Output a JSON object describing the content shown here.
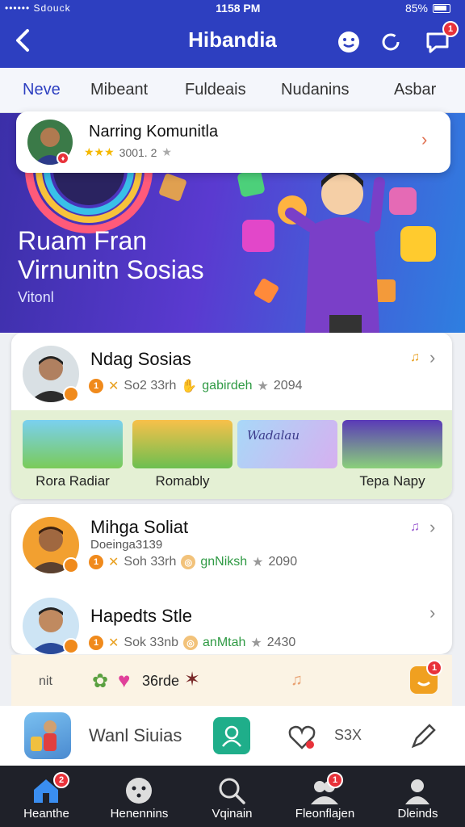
{
  "status": {
    "carrier": "•••••• Sdouck",
    "time": "1158 PM",
    "battery": "85%"
  },
  "appbar": {
    "title": "Hibandia",
    "badge": "1"
  },
  "tabs": [
    "Neve",
    "Mibeant",
    "Fuldeais",
    "Nudanins",
    "Asbar"
  ],
  "popup": {
    "title": "Narring Komunitla",
    "rating": "3001. 2"
  },
  "hero": {
    "line1": "Ruam Fran",
    "line2": "Virnunitn Sosias",
    "sub": "Vitonl"
  },
  "featured": {
    "name": "Ndag Sosias",
    "meta1": "So2 33rh",
    "meta2": "gabirdeh",
    "score": "2094",
    "thumbs": [
      {
        "label": "Rora Radiar",
        "text": ""
      },
      {
        "label": "Romably",
        "text": ""
      },
      {
        "label": "",
        "text": "Wadalau"
      },
      {
        "label": "Tepa Napy",
        "text": ""
      }
    ]
  },
  "list": [
    {
      "name": "Mihga Soliat",
      "sub": "Doeinga3139",
      "meta1": "Soh 33rh",
      "meta2": "gnNiksh",
      "score": "2090"
    },
    {
      "name": "Hapedts Stle",
      "sub": "",
      "meta1": "Sok 33nb",
      "meta2": "anMtah",
      "score": "2430"
    }
  ],
  "actions": {
    "left": "nit",
    "middle": "36rde",
    "badge": "1"
  },
  "bottomrow": {
    "label": "Wanl Siuias",
    "right": "S3X"
  },
  "nav": [
    {
      "label": "Heanthe",
      "badge": "2",
      "active": true
    },
    {
      "label": "Henennins",
      "badge": ""
    },
    {
      "label": "Vqinain",
      "badge": ""
    },
    {
      "label": "Fleonflajen",
      "badge": "1"
    },
    {
      "label": "Dleinds",
      "badge": ""
    }
  ],
  "colors": {
    "primary": "#2d3fc0",
    "accent": "#e8323a",
    "orange": "#f08a1c",
    "green": "#1fae8a"
  }
}
